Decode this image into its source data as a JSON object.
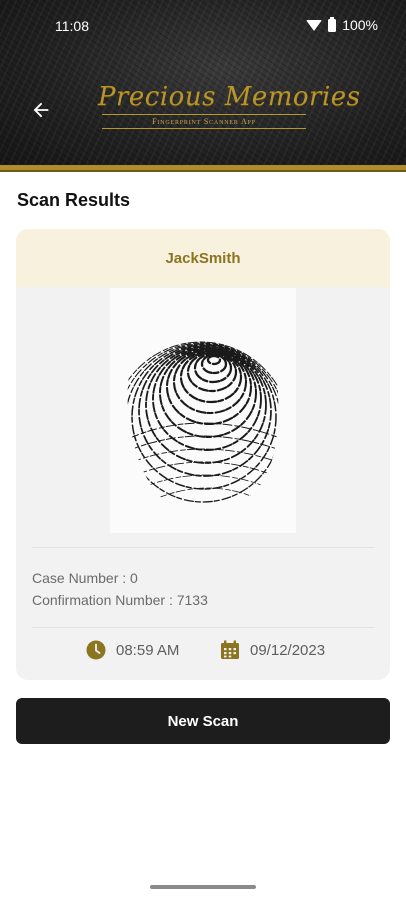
{
  "status_bar": {
    "time": "11:08",
    "battery": "100%"
  },
  "header": {
    "logo_title": "Precious Memories",
    "logo_subtitle": "Fingerprint Scanner App",
    "gold_color": "#b08d2a"
  },
  "page": {
    "title": "Scan Results"
  },
  "result": {
    "name": "JackSmith",
    "case_number": "Case Number : 0",
    "confirmation_number": "Confirmation Number : 7133",
    "time": "08:59 AM",
    "date": "09/12/2023",
    "accent_color": "#8b7521"
  },
  "actions": {
    "new_scan_label": "New Scan"
  }
}
